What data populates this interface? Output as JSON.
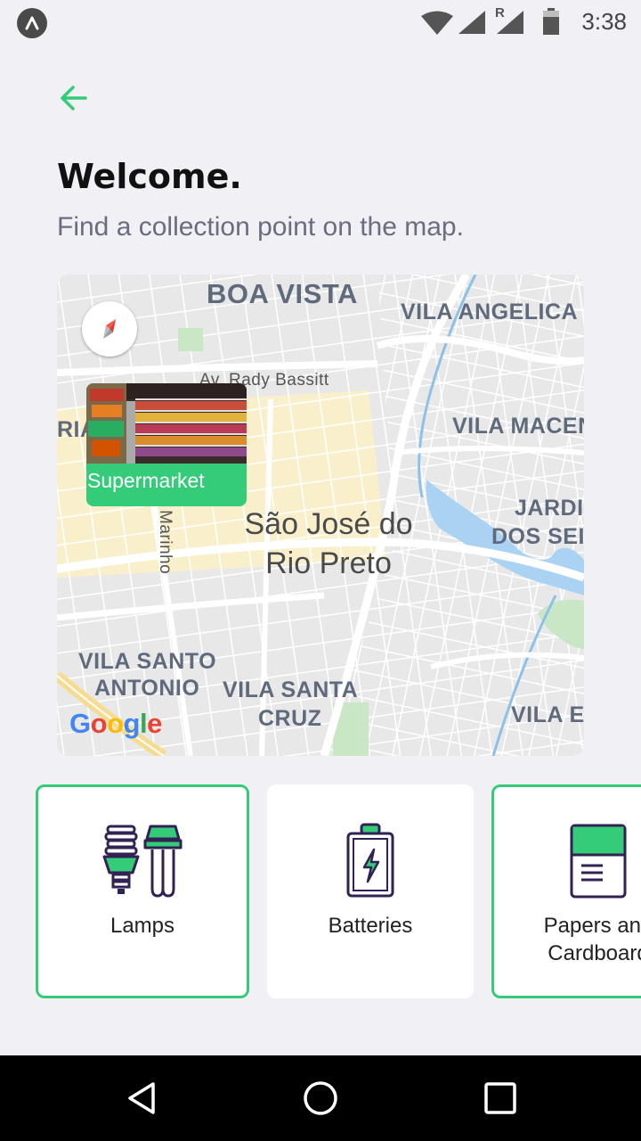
{
  "status_bar": {
    "time": "3:38",
    "icons": [
      "app-badge-icon",
      "wifi-icon",
      "signal-icon",
      "roaming-signal-icon",
      "battery-icon"
    ],
    "roaming_label": "R"
  },
  "header": {
    "back_icon": "arrow-left-icon",
    "title": "Welcome.",
    "subtitle": "Find a collection point on the map."
  },
  "map": {
    "labels": {
      "boa_vista": "BOA VISTA",
      "vila_angelica": "VILA ANGELICA",
      "rady_bassitt": "Av. Rady Bassitt",
      "ria": "RIA",
      "vila_macen": "VILA MACEN",
      "jardi": "JARDII",
      "dos_seix": "DOS SEIX",
      "city_line1": "São José do",
      "city_line2": "Rio Preto",
      "marinho": "Marinho",
      "vila_santo": "VILA SANTO",
      "antonio": "ANTONIO",
      "vila_santa": "VILA SANTA",
      "cruz": "CRUZ",
      "vila_ei": "VILA EI"
    },
    "marker": {
      "label": "Supermarket"
    },
    "google": [
      "G",
      "o",
      "o",
      "g",
      "l",
      "e"
    ],
    "compass_icon": "compass-icon"
  },
  "items": [
    {
      "label": "Lamps",
      "icon": "lamps-icon",
      "selected": true
    },
    {
      "label": "Batteries",
      "icon": "battery-icon",
      "selected": false
    },
    {
      "label": "Papers and\nCardboard",
      "icon": "paper-icon",
      "selected": true
    }
  ],
  "colors": {
    "accent": "#34CB79",
    "background": "#F0F0F5",
    "title": "#111111",
    "subtitle": "#6C6C80",
    "icon_outline": "#322153"
  },
  "nav_bar": {
    "icons": [
      "back-triangle-icon",
      "home-circle-icon",
      "recents-square-icon"
    ]
  }
}
